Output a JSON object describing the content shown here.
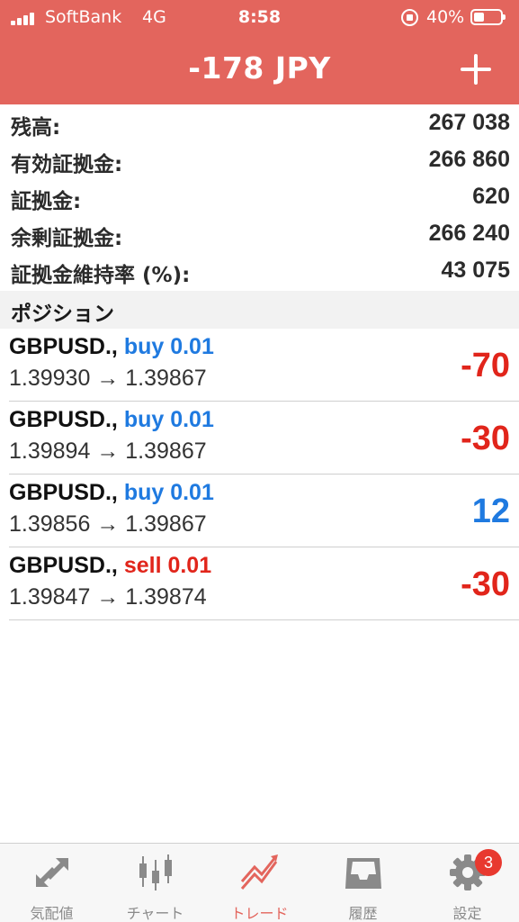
{
  "status_bar": {
    "carrier": "SoftBank",
    "network": "4G",
    "time": "8:58",
    "battery": "40%"
  },
  "header": {
    "title": "-178 JPY",
    "add_icon": "plus-icon",
    "background_color": "#e3655d"
  },
  "summary": [
    {
      "label": "残高:",
      "value": "267 038"
    },
    {
      "label": "有効証拠金:",
      "value": "266 860"
    },
    {
      "label": "証拠金:",
      "value": "620"
    },
    {
      "label": "余剰証拠金:",
      "value": "266 240"
    },
    {
      "label": "証拠金維持率 (%):",
      "value": "43 075"
    }
  ],
  "positions_section": {
    "title": "ポジション",
    "items": [
      {
        "symbol": "GBPUSD.,",
        "side": "buy 0.01",
        "prices": "1.39930 → 1.39867",
        "profit": "-70"
      },
      {
        "symbol": "GBPUSD.,",
        "side": "buy 0.01",
        "prices": "1.39894 → 1.39867",
        "profit": "-30"
      },
      {
        "symbol": "GBPUSD.,",
        "side": "buy 0.01",
        "prices": "1.39856 → 1.39867",
        "profit": "12"
      },
      {
        "symbol": "GBPUSD.,",
        "side": "sell 0.01",
        "prices": "1.39847 → 1.39874",
        "profit": "-30"
      }
    ]
  },
  "tab_bar": {
    "tabs": [
      {
        "label": "気配値",
        "icon": "quotes-arrows-icon"
      },
      {
        "label": "チャート",
        "icon": "candlestick-chart-icon"
      },
      {
        "label": "トレード",
        "icon": "trade-trend-icon"
      },
      {
        "label": "履歴",
        "icon": "history-inbox-icon"
      },
      {
        "label": "設定",
        "icon": "gear-icon",
        "badge": "3"
      }
    ],
    "active_color": "#e3655d",
    "inactive_color": "#8a8a8a"
  }
}
